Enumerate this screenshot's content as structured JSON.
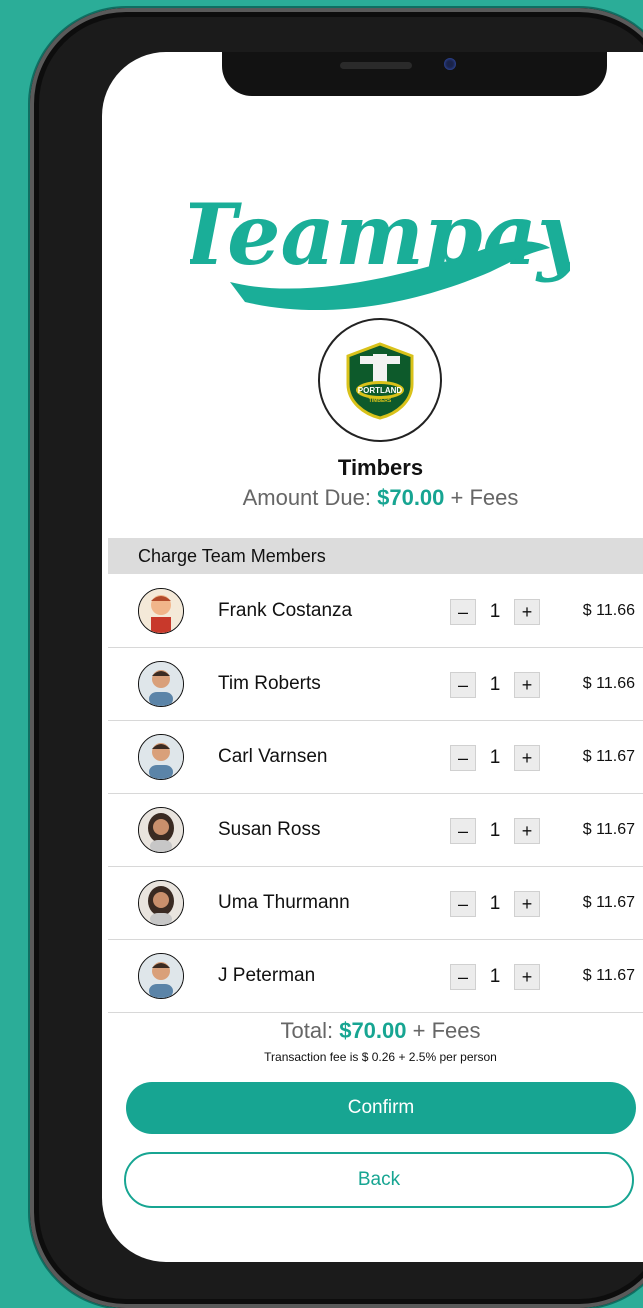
{
  "app": {
    "logo_text": "Teampay",
    "brand_color": "#17a592"
  },
  "team": {
    "name": "Timbers",
    "crest_text": "PORTLAND",
    "crest_subtext": "TIMBERS",
    "amount_label": "Amount Due:",
    "amount_value": "$70.00",
    "amount_suffix": "+ Fees"
  },
  "members_section": {
    "header": "Charge Team Members",
    "members": [
      {
        "name": "Frank Costanza",
        "qty": "1",
        "price": "$ 11.66",
        "avatar": "avatar-cartoon"
      },
      {
        "name": "Tim Roberts",
        "qty": "1",
        "price": "$ 11.66",
        "avatar": "avatar-man"
      },
      {
        "name": "Carl Varnsen",
        "qty": "1",
        "price": "$ 11.67",
        "avatar": "avatar-man"
      },
      {
        "name": "Susan Ross",
        "qty": "1",
        "price": "$ 11.67",
        "avatar": "avatar-woman"
      },
      {
        "name": "Uma Thurmann",
        "qty": "1",
        "price": "$ 11.67",
        "avatar": "avatar-woman"
      },
      {
        "name": "J Peterman",
        "qty": "1",
        "price": "$ 11.67",
        "avatar": "avatar-man"
      }
    ],
    "minus_label": "–",
    "plus_label": "+"
  },
  "summary": {
    "total_label": "Total:",
    "total_value": "$70.00",
    "total_suffix": "+ Fees",
    "fee_note": "Transaction fee is $ 0.26 + 2.5% per person"
  },
  "actions": {
    "confirm_label": "Confirm",
    "back_label": "Back"
  }
}
